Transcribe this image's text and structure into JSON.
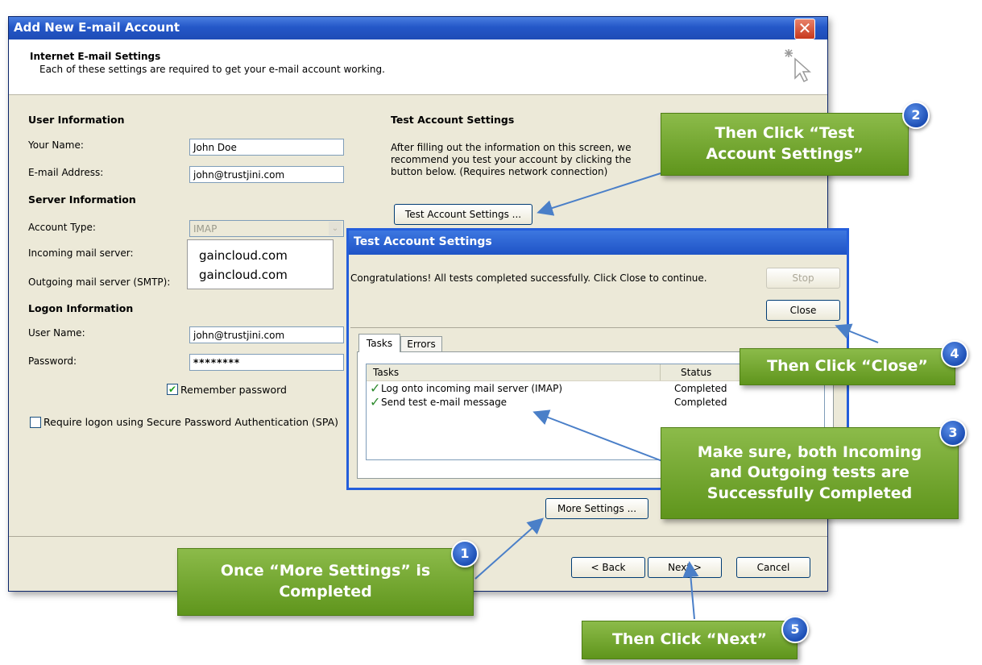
{
  "window": {
    "title": "Add New E-mail Account",
    "close_glyph": "✕",
    "header_title": "Internet E-mail Settings",
    "header_subtitle": "Each of these settings are required to get your e-mail account working.",
    "wizard_icon": "cursor-sparkle-icon"
  },
  "user_info": {
    "section": "User Information",
    "name_label": "Your Name:",
    "name_value": "John Doe",
    "email_label": "E-mail Address:",
    "email_value": "john@trustjini.com"
  },
  "server_info": {
    "section": "Server Information",
    "account_type_label": "Account Type:",
    "account_type_value": "IMAP",
    "incoming_label": "Incoming mail server:",
    "incoming_value": "gaincloud.com",
    "outgoing_label": "Outgoing mail server (SMTP):",
    "outgoing_value": "gaincloud.com"
  },
  "logon_info": {
    "section": "Logon Information",
    "username_label": "User Name:",
    "username_value": "john@trustjini.com",
    "password_label": "Password:",
    "password_value": "********",
    "remember_label": "Remember password",
    "remember_checked": true,
    "spa_label": "Require logon using Secure Password Authentication (SPA)",
    "spa_checked": false
  },
  "test_settings": {
    "section": "Test Account Settings",
    "line1": "After filling out the information on this screen, we",
    "line2": "recommend you test your account by clicking the",
    "line3": "button below. (Requires network connection)",
    "button": "Test Account Settings ..."
  },
  "buttons": {
    "more_settings": "More Settings ...",
    "back": "< Back",
    "next": "Next >",
    "cancel": "Cancel"
  },
  "test_dialog": {
    "title": "Test Account Settings",
    "message": "Congratulations! All tests completed successfully. Click Close to continue.",
    "stop": "Stop",
    "close": "Close",
    "tabs": [
      "Tasks",
      "Errors"
    ],
    "col_tasks": "Tasks",
    "col_status": "Status",
    "rows": [
      {
        "task": "Log onto incoming mail server (IMAP)",
        "status": "Completed"
      },
      {
        "task": "Send test e-mail message",
        "status": "Completed"
      }
    ]
  },
  "callouts": {
    "c1": "Once “More Settings” is Completed",
    "c1_badge": "1",
    "c2": "Then Click “Test Account Settings”",
    "c2_badge": "2",
    "c3": "Make sure, both Incoming and Outgoing tests are Successfully Completed",
    "c3_badge": "3",
    "c4": "Then Click “Close”",
    "c4_badge": "4",
    "c5": "Then Click “Next”",
    "c5_badge": "5"
  },
  "colors": {
    "callout_green": "#6fa52c",
    "badge_blue": "#1d4fb5",
    "arrow_blue": "#4a7fc8",
    "xp_title_blue": "#245edb"
  }
}
